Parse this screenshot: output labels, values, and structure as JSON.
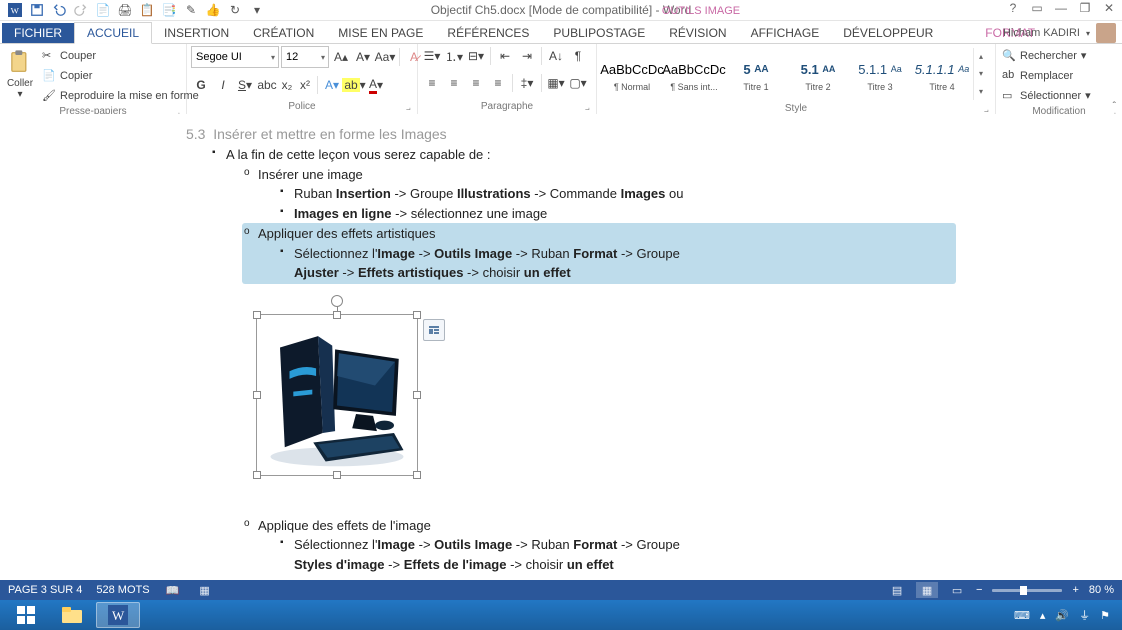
{
  "qat_title": "Objectif Ch5.docx [Mode de compatibilité] - Word",
  "contextual_tab_group": "OUTILS IMAGE",
  "window_controls": {
    "help": "?",
    "ribbon_opts": "▭",
    "min": "—",
    "restore": "❐",
    "close": "✕"
  },
  "tabs": {
    "file": "FICHIER",
    "home": "ACCUEIL",
    "insert": "INSERTION",
    "design": "CRÉATION",
    "layout": "MISE EN PAGE",
    "references": "RÉFÉRENCES",
    "mailings": "PUBLIPOSTAGE",
    "review": "RÉVISION",
    "view": "AFFICHAGE",
    "developer": "DÉVELOPPEUR",
    "format": "FORMAT"
  },
  "user_name": "Hicham KADIRI",
  "ribbon": {
    "clipboard": {
      "label": "Presse-papiers",
      "paste": "Coller",
      "cut": "Couper",
      "copy": "Copier",
      "format_painter": "Reproduire la mise en forme"
    },
    "font": {
      "label": "Police",
      "name": "Segoe UI",
      "size": "12"
    },
    "paragraph": {
      "label": "Paragraphe"
    },
    "styles": {
      "label": "Style",
      "items": [
        {
          "sample": "AaBbCcDc",
          "name": "¶ Normal"
        },
        {
          "sample": "AaBbCcDc",
          "name": "¶ Sans int..."
        },
        {
          "sample": "5",
          "name": "Titre 1"
        },
        {
          "sample": "5.1",
          "name": "Titre 2"
        },
        {
          "sample": "5.1.1",
          "name": "Titre 3"
        },
        {
          "sample": "5.1.1.1",
          "name": "Titre 4"
        }
      ],
      "sample_suffix": [
        "",
        "",
        "AA",
        "AA",
        "Aa",
        "Aa"
      ]
    },
    "editing": {
      "label": "Modification",
      "find": "Rechercher",
      "replace": "Remplacer",
      "select": "Sélectionner"
    }
  },
  "doc": {
    "heading_num": "5.3",
    "heading_text": "Insérer et mettre en forme les Images",
    "l1": "A la fin de cette leçon vous serez capable de :",
    "l2a": "Insérer une image",
    "l3a_pre": "Ruban ",
    "l3a_b1": "Insertion",
    "l3a_mid": " -> Groupe ",
    "l3a_b2": "Illustrations",
    "l3a_mid2": " -> Commande ",
    "l3a_b3": "Images",
    "l3a_post": " ou",
    "l3a2_b": "Images en ligne",
    "l3a2_post": " -> sélectionnez une image",
    "l2b": "Appliquer des effets artistiques",
    "l3b_pre": "Sélectionnez l'",
    "l3b_b1": "Image",
    "l3b_mid": " -> ",
    "l3b_b2": "Outils Image",
    "l3b_mid2": " -> Ruban ",
    "l3b_b3": "Format",
    "l3b_mid3": " -> Groupe",
    "l3b2_b1": "Ajuster",
    "l3b2_mid": " -> ",
    "l3b2_b2": "Effets artistiques",
    "l3b2_mid2": " -> choisir ",
    "l3b2_b3": "un effet",
    "l2c": "Applique des effets de l'image",
    "l3c_pre": "Sélectionnez l'",
    "l3c_b1": "Image",
    "l3c_mid": " -> ",
    "l3c_b2": "Outils Image",
    "l3c_mid2": " -> Ruban ",
    "l3c_b3": "Format",
    "l3c_mid3": " -> Groupe",
    "l3c2_b1": "Styles d'image",
    "l3c2_mid": " -> ",
    "l3c2_b2": "Effets de l'image",
    "l3c2_mid2": " -> choisir ",
    "l3c2_b3": "un effet"
  },
  "status": {
    "page": "PAGE 3 SUR 4",
    "words": "528 MOTS",
    "zoom": "80 %",
    "zoom_minus": "−",
    "zoom_plus": "+"
  },
  "taskbar": {
    "time": ""
  }
}
